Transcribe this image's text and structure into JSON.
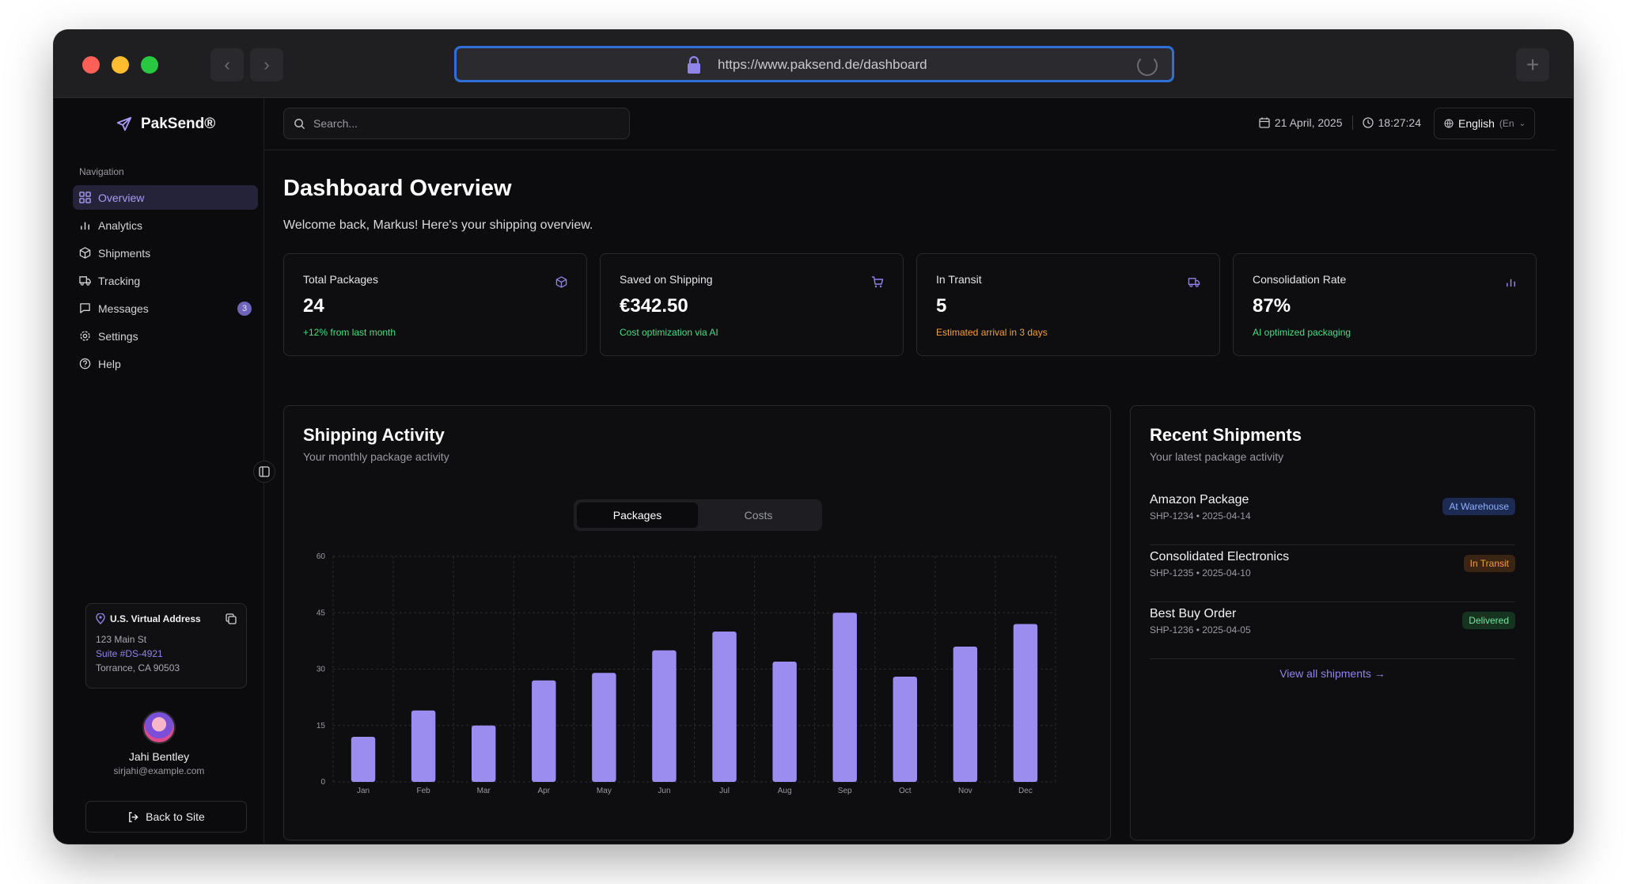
{
  "browser": {
    "url": "https://www.paksend.de/dashboard"
  },
  "sidebar": {
    "brand": "PakSend®",
    "nav_heading": "Navigation",
    "items": [
      {
        "label": "Overview",
        "icon": "grid-icon",
        "active": true
      },
      {
        "label": "Analytics",
        "icon": "bar-chart-icon"
      },
      {
        "label": "Shipments",
        "icon": "package-icon"
      },
      {
        "label": "Tracking",
        "icon": "truck-icon"
      },
      {
        "label": "Messages",
        "icon": "message-icon",
        "badge": "3"
      },
      {
        "label": "Settings",
        "icon": "gear-icon"
      },
      {
        "label": "Help",
        "icon": "help-circle-icon"
      }
    ],
    "address": {
      "title": "U.S. Virtual Address",
      "line1": "123 Main St",
      "suite": "Suite #DS-4921",
      "city": "Torrance, CA 90503"
    },
    "user": {
      "name": "Jahi Bentley",
      "email": "sirjahi@example.com"
    },
    "back_label": "Back to Site"
  },
  "topbar": {
    "search_placeholder": "Search...",
    "date": "21 April, 2025",
    "time": "18:27:24",
    "language": "English",
    "language_sub": "(En"
  },
  "page": {
    "title": "Dashboard Overview",
    "subtitle": "Welcome back, Markus! Here's your shipping overview."
  },
  "stats": [
    {
      "label": "Total Packages",
      "value": "24",
      "note": "+12% from last month",
      "icon": "package-icon",
      "tone": "green"
    },
    {
      "label": "Saved on Shipping",
      "value": "€342.50",
      "note": "Cost optimization via AI",
      "icon": "cart-icon",
      "tone": "green"
    },
    {
      "label": "In Transit",
      "value": "5",
      "note": "Estimated arrival in 3 days",
      "icon": "truck-icon",
      "tone": "orange"
    },
    {
      "label": "Consolidation Rate",
      "value": "87%",
      "note": "AI optimized packaging",
      "icon": "bar-chart-icon",
      "tone": "green"
    }
  ],
  "activity": {
    "title": "Shipping Activity",
    "subtitle": "Your monthly package activity",
    "tabs": [
      "Packages",
      "Costs"
    ],
    "active_tab": "Packages"
  },
  "chart_data": {
    "type": "bar",
    "categories": [
      "Jan",
      "Feb",
      "Mar",
      "Apr",
      "May",
      "Jun",
      "Jul",
      "Aug",
      "Sep",
      "Oct",
      "Nov",
      "Dec"
    ],
    "values": [
      12,
      19,
      15,
      27,
      29,
      35,
      40,
      32,
      45,
      28,
      36,
      42
    ],
    "ylim": [
      0,
      60
    ],
    "yticks": [
      0,
      15,
      30,
      45,
      60
    ],
    "grid": true,
    "bar_color": "#9b8cf0"
  },
  "recent": {
    "title": "Recent Shipments",
    "subtitle": "Your latest package activity",
    "items": [
      {
        "name": "Amazon Package",
        "meta": "SHP-1234 • 2025-04-14",
        "status": "At Warehouse",
        "tone": "blue"
      },
      {
        "name": "Consolidated Electronics",
        "meta": "SHP-1235 • 2025-04-10",
        "status": "In Transit",
        "tone": "orange"
      },
      {
        "name": "Best Buy Order",
        "meta": "SHP-1236 • 2025-04-05",
        "status": "Delivered",
        "tone": "green"
      }
    ],
    "view_all": "View all shipments →"
  },
  "colors": {
    "accent": "#8f84e8",
    "background": "#0c0c0e",
    "positive": "#4ade80",
    "warning": "#f59e3b"
  }
}
